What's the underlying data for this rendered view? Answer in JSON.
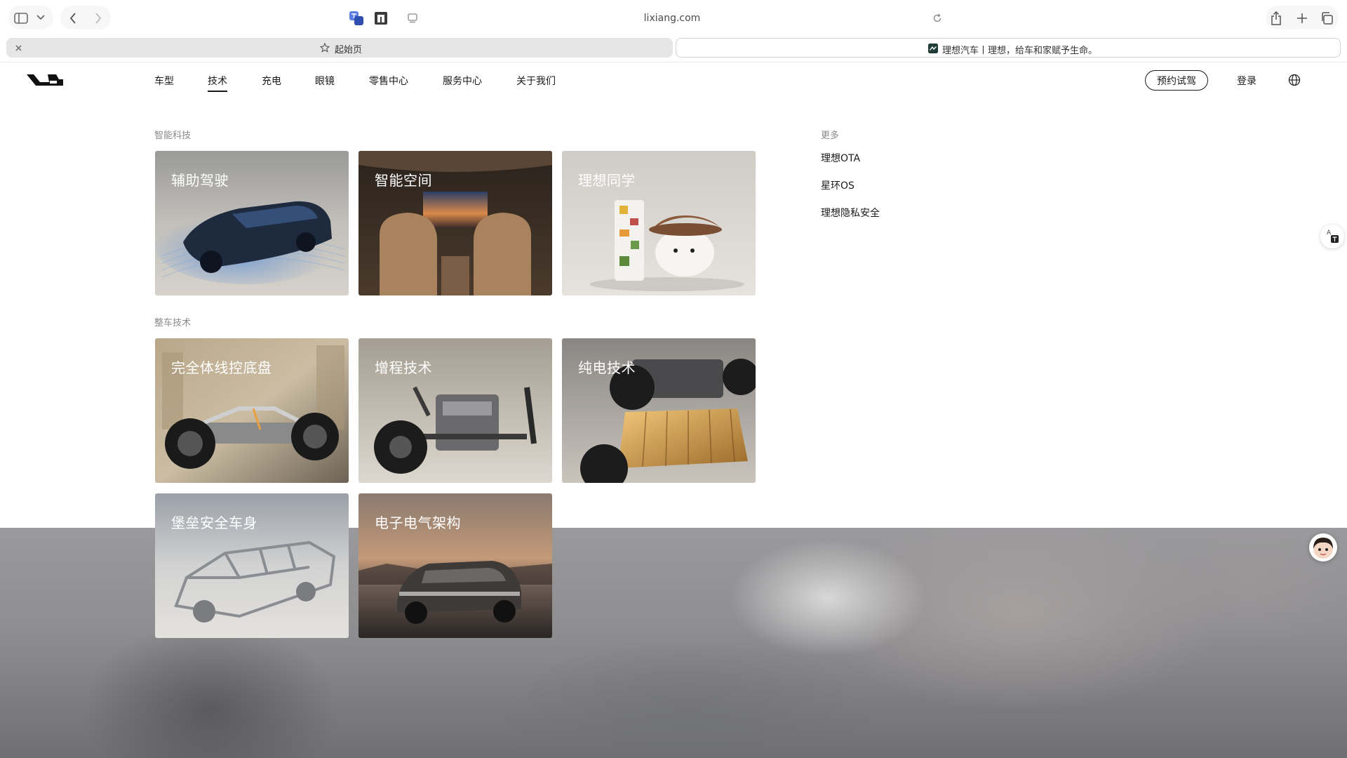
{
  "browser": {
    "url": "lixiang.com",
    "tabs": [
      {
        "label": "起始页"
      },
      {
        "label": "理想汽车丨理想，给车和家赋予生命。"
      }
    ]
  },
  "nav": {
    "items": [
      "车型",
      "技术",
      "充电",
      "眼镜",
      "零售中心",
      "服务中心",
      "关于我们"
    ],
    "active_index": 1,
    "test_drive": "预约试驾",
    "login": "登录"
  },
  "menu": {
    "smart_tech": {
      "label": "智能科技",
      "cards": [
        "辅助驾驶",
        "智能空间",
        "理想同学"
      ]
    },
    "vehicle_tech": {
      "label": "整车技术",
      "cards": [
        "完全体线控底盘",
        "增程技术",
        "纯电技术",
        "堡垒安全车身",
        "电子电气架构"
      ]
    },
    "more": {
      "label": "更多",
      "links": [
        "理想OTA",
        "星环OS",
        "理想隐私安全"
      ]
    }
  },
  "colors": {
    "accent_text": "#1a1a1a",
    "section_label": "#8a8a8a"
  },
  "icons": [
    "sidebar-icon",
    "chevron-down-icon",
    "back-arrow-icon",
    "forward-arrow-icon",
    "translate-icon",
    "reader-extension-icon",
    "page-menu-icon",
    "reload-icon",
    "share-icon",
    "plus-icon",
    "tabs-overview-icon",
    "close-icon",
    "star-icon",
    "favicon",
    "brand-logo",
    "globe-icon",
    "assistant-avatar"
  ]
}
